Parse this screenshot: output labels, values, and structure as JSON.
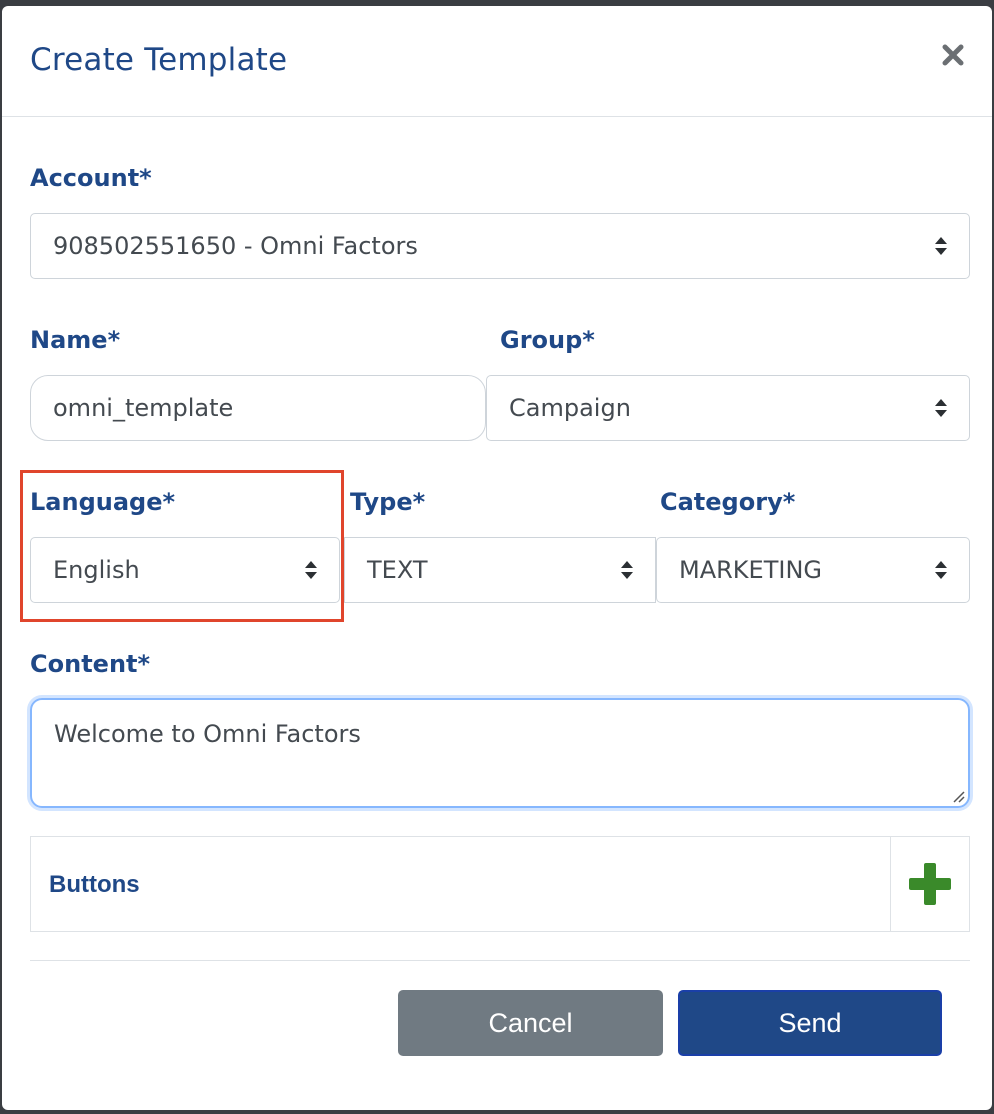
{
  "dialog": {
    "title": "Create Template"
  },
  "form": {
    "account": {
      "label": "Account*",
      "value": "908502551650 - Omni Factors"
    },
    "name": {
      "label": "Name*",
      "value": "omni_template"
    },
    "group": {
      "label": "Group*",
      "value": "Campaign"
    },
    "language": {
      "label": "Language*",
      "value": "English"
    },
    "type": {
      "label": "Type*",
      "value": "TEXT"
    },
    "category": {
      "label": "Category*",
      "value": "MARKETING"
    },
    "content": {
      "label": "Content*",
      "value": "Welcome to Omni Factors"
    },
    "buttons": {
      "label": "Buttons"
    }
  },
  "footer": {
    "cancel_label": "Cancel",
    "send_label": "Send"
  },
  "icons": {
    "close": "close-icon",
    "select_arrows": "sort-arrows-icon",
    "add": "plus-icon"
  },
  "colors": {
    "primary": "#1f4887",
    "secondary": "#707a82",
    "add_green": "#3a8a2a",
    "highlight": "#e0452c",
    "focus": "#86b7fe"
  }
}
